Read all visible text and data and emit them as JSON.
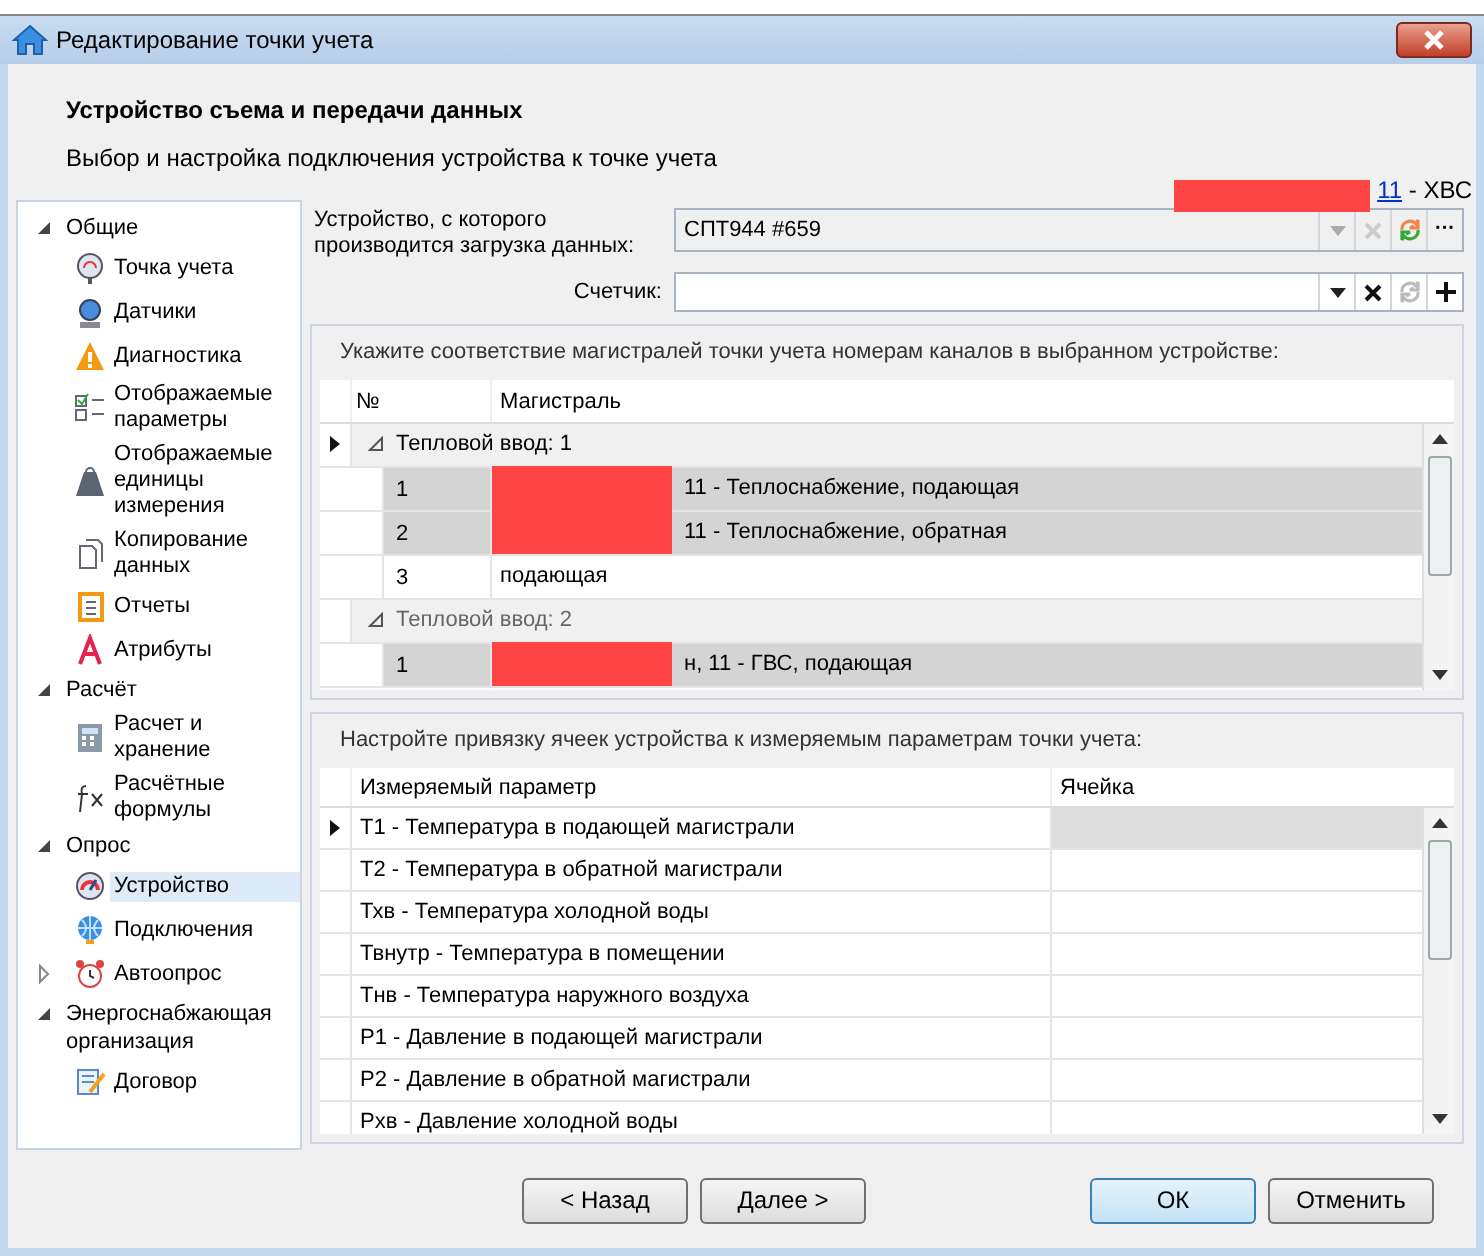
{
  "window": {
    "title": "Редактирование точки учета"
  },
  "header": {
    "title": "Устройство съема и передачи данных",
    "subtitle": "Выбор и настройка подключения устройства к точке учета",
    "address_link": "11",
    "address_suffix": " - ХВС"
  },
  "sidebar": {
    "groups": [
      {
        "label": "Общие",
        "expanded": true,
        "children": [
          {
            "label": "Точка учета",
            "selected": false,
            "kind": "item"
          },
          {
            "label": "Датчики",
            "selected": false,
            "kind": "item"
          },
          {
            "label": "Диагностика",
            "selected": false,
            "kind": "item"
          },
          {
            "label": "Отображаемые параметры",
            "selected": false,
            "kind": "item"
          },
          {
            "label": "Отображаемые единицы измерения",
            "selected": false,
            "kind": "item"
          },
          {
            "label": "Копирование данных",
            "selected": false,
            "kind": "item"
          },
          {
            "label": "Отчеты",
            "selected": false,
            "kind": "item"
          },
          {
            "label": "Атрибуты",
            "selected": false,
            "kind": "item"
          }
        ]
      },
      {
        "label": "Расчёт",
        "expanded": true,
        "children": [
          {
            "label": "Расчет и хранение",
            "selected": false,
            "kind": "item"
          },
          {
            "label": "Расчётные формулы",
            "selected": false,
            "kind": "item"
          }
        ]
      },
      {
        "label": "Опрос",
        "expanded": true,
        "children": [
          {
            "label": "Устройство",
            "selected": true,
            "kind": "item"
          },
          {
            "label": "Подключения",
            "selected": false,
            "kind": "item"
          },
          {
            "label": "Автоопрос",
            "selected": false,
            "kind": "node",
            "expanded": false
          }
        ]
      },
      {
        "label": "Энергоснабжающая организация",
        "expanded": true,
        "children": [
          {
            "label": "Договор",
            "selected": false,
            "kind": "item"
          }
        ]
      }
    ]
  },
  "device": {
    "label": "Устройство, с которого производится загрузка данных:",
    "value": "СПТ944 #659",
    "more_button": "···"
  },
  "counter": {
    "label": "Счетчик:"
  },
  "channels": {
    "caption": "Укажите соответствие магистралей точки учета номерам каналов в выбранном устройстве:",
    "columns": [
      "№",
      "Магистраль"
    ],
    "groups": [
      {
        "label": "Тепловой ввод: 1",
        "current": true,
        "expanded": true,
        "rows": [
          {
            "number": "1",
            "line": "11 - Теплоснабжение, подающая",
            "redacted": true,
            "selected": true
          },
          {
            "number": "2",
            "line": "11 - Теплоснабжение, обратная",
            "redacted": true,
            "selected": true
          },
          {
            "number": "3",
            "line": "подающая",
            "redacted": false,
            "selected": false
          }
        ]
      },
      {
        "label": "Тепловой ввод: 2",
        "current": false,
        "expanded": true,
        "rows": [
          {
            "number": "1",
            "line": "н, 11 - ГВС, подающая",
            "redacted": true,
            "selected": true
          }
        ]
      }
    ]
  },
  "cells": {
    "caption": "Настройте привязку ячеек устройства к измеряемым параметрам точки учета:",
    "columns": [
      "Измеряемый параметр",
      "Ячейка"
    ],
    "rows": [
      {
        "parameter": "T1 - Температура в подающей магистрали",
        "current": true
      },
      {
        "parameter": "T2 - Температура в обратной магистрали",
        "current": false
      },
      {
        "parameter": "Тхв - Температура холодной воды",
        "current": false
      },
      {
        "parameter": "Твнутр - Температура в помещении",
        "current": false
      },
      {
        "parameter": "Тнв - Температура наружного воздуха",
        "current": false
      },
      {
        "parameter": "P1 - Давление в подающей магистрали",
        "current": false
      },
      {
        "parameter": "P2 - Давление в обратной магистрали",
        "current": false
      },
      {
        "parameter": "Рхв - Давление холодной воды",
        "current": false
      }
    ]
  },
  "buttons": [
    {
      "label": "< Назад",
      "default": false
    },
    {
      "label": "Далее >",
      "default": false
    },
    {
      "label": "ОК",
      "default": true
    },
    {
      "label": "Отменить",
      "default": false
    }
  ]
}
